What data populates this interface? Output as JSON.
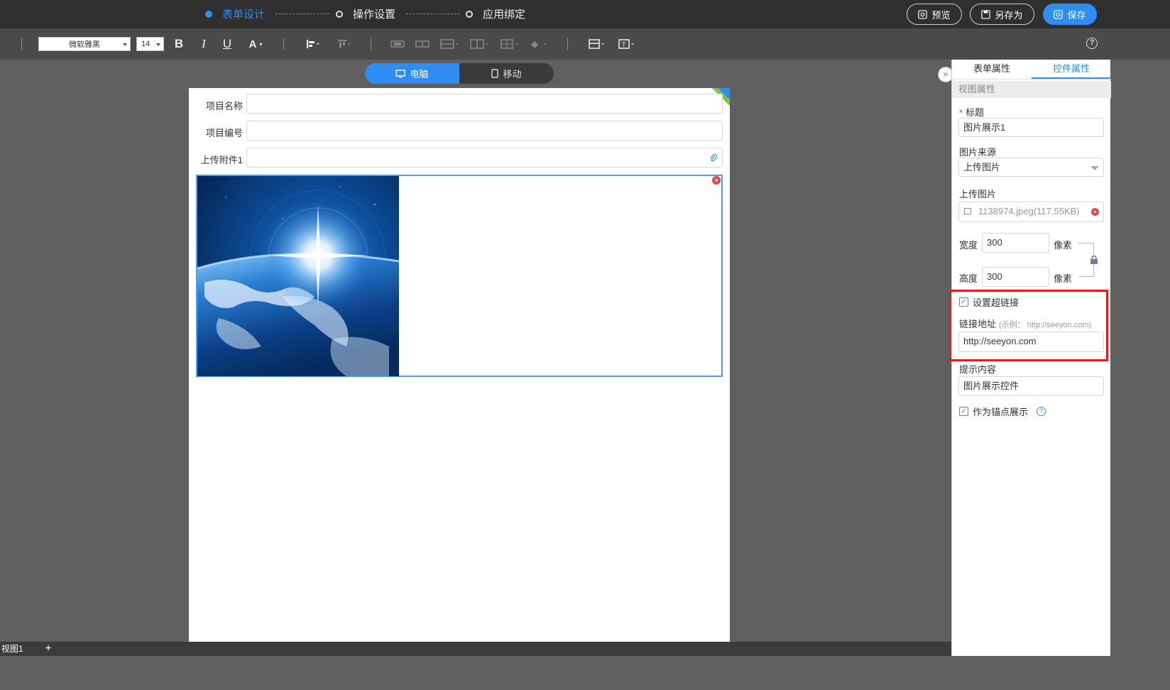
{
  "topbar": {
    "steps": [
      {
        "label": "表单设计",
        "active": true
      },
      {
        "label": "操作设置",
        "active": false
      },
      {
        "label": "应用绑定",
        "active": false
      }
    ],
    "buttons": {
      "preview": "预览",
      "save_as": "另存为",
      "save": "保存"
    }
  },
  "toolbar": {
    "font_family": "微软雅黑",
    "font_size": "14",
    "bold": "B",
    "italic": "I",
    "underline": "U",
    "font_color": "A"
  },
  "device_toggle": {
    "desktop": "电脑",
    "mobile": "移动"
  },
  "form": {
    "fields": [
      {
        "label": "项目名称",
        "value": ""
      },
      {
        "label": "项目编号",
        "value": ""
      },
      {
        "label": "上传附件1",
        "value": ""
      }
    ]
  },
  "bottom": {
    "view_tab": "视图1",
    "add": "+"
  },
  "panel": {
    "tabs": [
      "表单属性",
      "控件属性"
    ],
    "active_tab": "控件属性",
    "section": "视图属性",
    "title_label": "标题",
    "title_value": "图片展示1",
    "source_label": "图片来源",
    "source_value": "上传图片",
    "upload_label": "上传图片",
    "upload_file": "1138974.jpeg(117.55KB)",
    "width_label": "宽度",
    "width_value": "300",
    "height_label": "高度",
    "height_value": "300",
    "unit": "像素",
    "hyperlink_label": "设置超链接",
    "hyperlink_checked": true,
    "link_label": "链接地址",
    "link_hint": "(示例：  http://seeyon.com)",
    "link_value": "http://seeyon.com",
    "tip_label": "提示内容",
    "tip_value": "图片展示控件",
    "anchor_label": "作为锚点展示",
    "anchor_checked": true
  },
  "colors": {
    "accent": "#2f8cf0",
    "highlight": "#e51c1c",
    "topbar": "#2f2f2f",
    "toolbar": "#4a4a4a"
  }
}
